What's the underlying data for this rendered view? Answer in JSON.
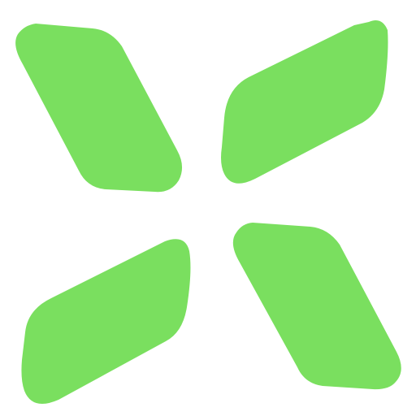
{
  "logo": {
    "icon": "four-petal-x-logo-icon",
    "colors": {
      "background": "#ffffff",
      "petal": "#7ADF5F"
    }
  }
}
